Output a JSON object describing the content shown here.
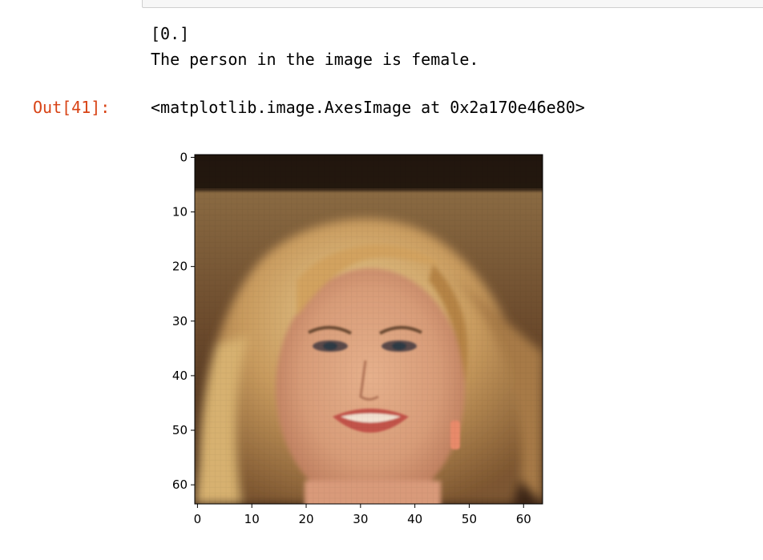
{
  "output": {
    "stream_lines": [
      "[0.]",
      "The person in the image is female."
    ],
    "prompt": "Out[41]:",
    "result_repr": "<matplotlib.image.AxesImage at 0x2a170e46e80>"
  },
  "chart_data": {
    "type": "heatmap",
    "x_ticks": [
      "0",
      "10",
      "20",
      "30",
      "40",
      "50",
      "60"
    ],
    "y_ticks": [
      "0",
      "10",
      "20",
      "30",
      "40",
      "50",
      "60"
    ],
    "xlim": [
      -0.5,
      63.5
    ],
    "ylim": [
      63.5,
      -0.5
    ],
    "image_shape": [
      64,
      64
    ],
    "grid": false,
    "content": "face-photo"
  },
  "colors": {
    "prompt_red": "#d84315",
    "cell_border": "#cfcfcf"
  }
}
